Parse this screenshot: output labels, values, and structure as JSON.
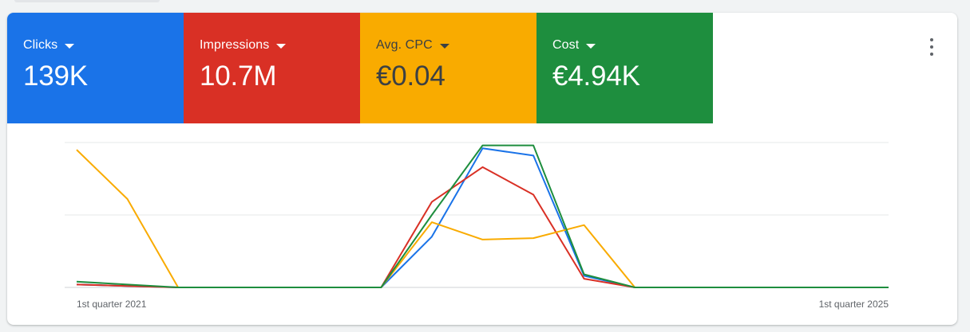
{
  "metrics": [
    {
      "label": "Clicks",
      "value": "139K",
      "bg": "#1a73e8",
      "fg": "#ffffff"
    },
    {
      "label": "Impressions",
      "value": "10.7M",
      "bg": "#d93025",
      "fg": "#ffffff"
    },
    {
      "label": "Avg. CPC",
      "value": "€0.04",
      "bg": "#f9ab00",
      "fg": "#3c4043"
    },
    {
      "label": "Cost",
      "value": "€4.94K",
      "bg": "#1e8e3e",
      "fg": "#ffffff"
    }
  ],
  "menu": {
    "icon": "more-vert-icon"
  },
  "chart_data": {
    "type": "line",
    "x": [
      "1st quarter 2021",
      "",
      "",
      "",
      "",
      "",
      "",
      "",
      "",
      "",
      "",
      "",
      "",
      "",
      "",
      "",
      "1st quarter 2025"
    ],
    "x_tick_labels": [
      "1st quarter 2021",
      "1st quarter 2025"
    ],
    "ylim": [
      0,
      1
    ],
    "grid": true,
    "series": [
      {
        "color": "#1a73e8",
        "values": [
          0.02,
          0.01,
          0,
          0,
          0,
          0,
          0,
          0.35,
          0.96,
          0.91,
          0.08,
          0,
          0,
          0,
          0,
          0,
          0
        ]
      },
      {
        "color": "#d93025",
        "values": [
          0.02,
          0.01,
          0,
          0,
          0,
          0,
          0,
          0.59,
          0.83,
          0.64,
          0.06,
          0,
          0,
          0,
          0,
          0,
          0
        ]
      },
      {
        "color": "#f9ab00",
        "values": [
          0.95,
          0.61,
          0,
          0,
          0,
          0,
          0,
          0.45,
          0.33,
          0.34,
          0.43,
          0,
          0,
          0,
          0,
          0,
          0
        ]
      },
      {
        "color": "#1e8e3e",
        "values": [
          0.04,
          0.02,
          0,
          0,
          0,
          0,
          0,
          0.5,
          0.98,
          0.98,
          0.09,
          0,
          0,
          0,
          0,
          0,
          0
        ]
      }
    ]
  }
}
